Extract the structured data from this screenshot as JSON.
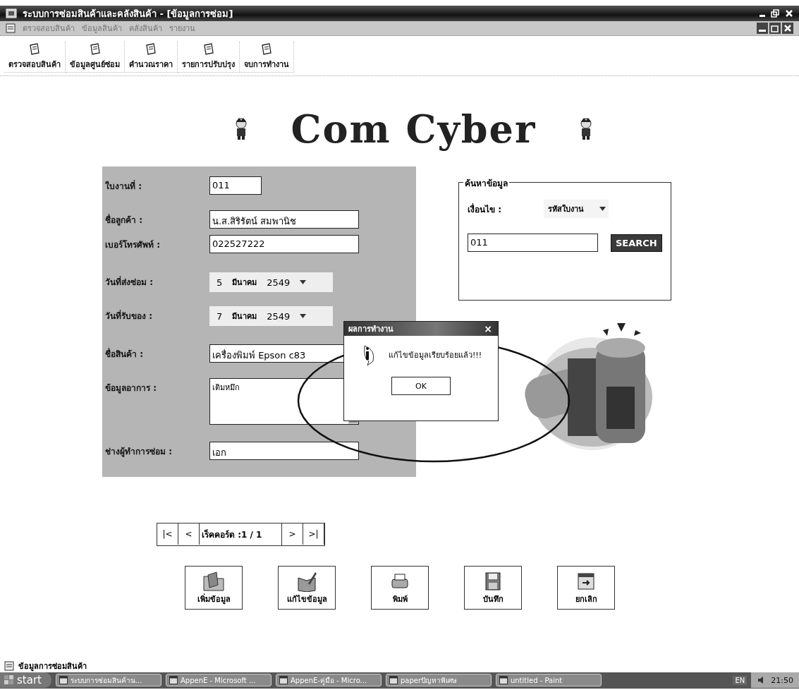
{
  "window": {
    "title": "ระบบการซ่อมสินค้าและคลังสินค้า - [ข้อมูลการซ่อม]"
  },
  "menu": [
    "ตรวจสอบสินค้า",
    "ข้อมูลสินค้า",
    "คลังสินค้า",
    "รายงาน"
  ],
  "toolbar": [
    "ตรวจสอบสินค้า",
    "ข้อมูลศูนย์ซ่อม",
    "คำนวณราคา",
    "รายการปรับปรุง",
    "จบการทำงาน"
  ],
  "logo": "Com Cyber",
  "form": [
    {
      "kind": "text",
      "label": "ใบงานที่ :",
      "value": "011"
    },
    {
      "kind": "text",
      "label": "ชื่อลูกค้า :",
      "value": "น.ส.สิริรัตน์ สมพานิช"
    },
    {
      "kind": "text",
      "label": "เบอร์โทรศัพท์ :",
      "value": "022527222"
    },
    {
      "kind": "date",
      "label": "วันที่ส่งซ่อม :",
      "day": "5",
      "month": "มีนาคม",
      "year": "2549"
    },
    {
      "kind": "date",
      "label": "วันที่รับของ :",
      "day": "7",
      "month": "มีนาคม",
      "year": "2549"
    },
    {
      "kind": "text",
      "label": "ชื่อสินค้า :",
      "value": "เครื่องพิมพ์ Epson c83"
    },
    {
      "kind": "memo",
      "label": "ข้อมูลอาการ :",
      "value": "เติมหมึก"
    },
    {
      "kind": "text",
      "label": "ช่างผู้ทำการซ่อม :",
      "value": "เอก"
    }
  ],
  "search": {
    "title": "ค้นหาข้อมูล",
    "condition_label": "เงื่อนไข :",
    "condition": "รหัสใบงาน",
    "query": "011",
    "button": "SEARCH"
  },
  "dialog": {
    "title": "ผลการทำงาน",
    "close": "×",
    "message": "แก้ไขข้อมูลเรียบร้อยแล้ว!!!",
    "button": "OK"
  },
  "record_nav": {
    "first": "|<",
    "prev": "<",
    "label": "เร็คคอร์ด :1 / 1",
    "next": ">",
    "last": ">|"
  },
  "actions": [
    "เพิ่มข้อมูล",
    "แก้ไขข้อมูล",
    "พิมพ์",
    "บันทึก",
    "ยกเลิก"
  ],
  "status_bar": "ข้อมูลการซ่อมสินค้า",
  "taskbar": {
    "start": "start",
    "tasks": [
      "ระบบการซ่อมสินค้าน...",
      "AppenE - Microsoft ...",
      "AppenE-คู่มือ - Micro...",
      "paperปัญหาพิเศษ",
      "untitled - Paint"
    ],
    "language": "EN",
    "clock": "21:50"
  }
}
